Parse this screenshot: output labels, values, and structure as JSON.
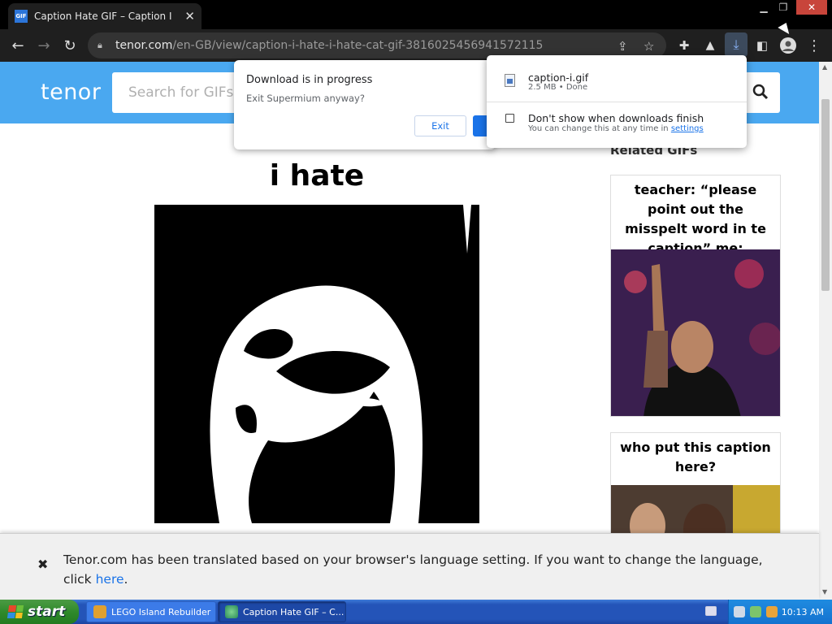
{
  "browser": {
    "tab_title": "Caption Hate GIF – Caption I Hate",
    "tab_favicon": "GIF",
    "url_host": "tenor.com",
    "url_path": "/en-GB/view/caption-i-hate-i-hate-cat-gif-3816025456941572115"
  },
  "site": {
    "logo": "tenor",
    "search_placeholder": "Search for GIFs",
    "accent_color": "#4aa8f0"
  },
  "main_gif": {
    "caption": "i hate"
  },
  "sidebar": {
    "title": "Related GIFs",
    "cards": [
      {
        "caption": "teacher: “please point out the misspelt word in te caption” me:"
      },
      {
        "caption": "who put this caption here?"
      }
    ]
  },
  "translate_bar": {
    "close_glyph": "✖",
    "message": "Tenor.com has been translated based on your browser's language setting. If you want to change the language, click",
    "link_text": "here",
    "after_link": "."
  },
  "exit_dialog": {
    "title": "Download is in progress",
    "subtitle": "Exit Supermium anyway?",
    "exit_label": "Exit"
  },
  "downloads_bubble": {
    "file_name": "caption-i.gif",
    "file_meta": "2.5 MB • Done",
    "checkbox_label": "Don't show when downloads finish",
    "help_text": "You can change this at any time in",
    "help_link": "settings"
  },
  "taskbar": {
    "start_label": "start",
    "tasks": [
      {
        "label": "LEGO Island Rebuilder"
      },
      {
        "label": "Caption Hate GIF – C..."
      }
    ],
    "clock": "10:13 AM"
  }
}
